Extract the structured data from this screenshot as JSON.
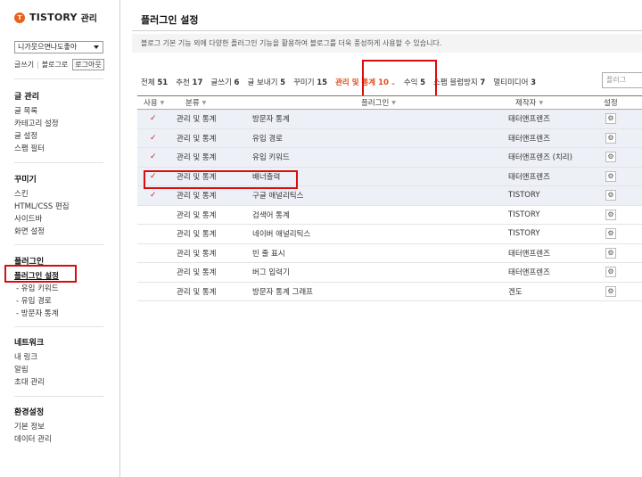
{
  "brand": {
    "logo_glyph": "T",
    "name": "TISTORY",
    "sub": "관리"
  },
  "blog_select": {
    "value": "니가뭇으면나도좋아"
  },
  "side_links": {
    "write": "글쓰기",
    "blog": "블로그로",
    "logout": "로그아웃"
  },
  "menu": {
    "posts": {
      "head": "글 관리",
      "items": [
        "글 목록",
        "카테고리 설정",
        "글 설정",
        "스팸 필터"
      ]
    },
    "decor": {
      "head": "꾸미기",
      "items": [
        "스킨",
        "HTML/CSS 편집",
        "사이드바",
        "화면 설정"
      ]
    },
    "plugins": {
      "head": "플러그인",
      "active": "플러그인 설정",
      "subs": [
        "- 유입 키워드",
        "- 유입 경로",
        "- 방문자 통계"
      ]
    },
    "network": {
      "head": "네트워크",
      "items": [
        "내 링크",
        "알림",
        "초대 관리"
      ]
    },
    "settings": {
      "head": "환경설정",
      "items": [
        "기본 정보",
        "데이터 관리"
      ]
    }
  },
  "page": {
    "title": "플러그인 설정",
    "description": "블로그 기본 기능 외에 다양한 플러그인 기능을 활용하여 블로그를 더욱 풍성하게 사용할 수 있습니다.",
    "search_placeholder": "플러그"
  },
  "tabs": [
    {
      "label": "전체",
      "count": "51"
    },
    {
      "label": "추천",
      "count": "17"
    },
    {
      "label": "글쓰기",
      "count": "6"
    },
    {
      "label": "글 보내기",
      "count": "5"
    },
    {
      "label": "꾸미기",
      "count": "15"
    },
    {
      "label": "관리 및 통계",
      "count": "10",
      "active": true,
      "chevron": "⌄"
    },
    {
      "label": "수익",
      "count": "5"
    },
    {
      "label": "스팸 블럼방지",
      "count": "7"
    },
    {
      "label": "멀티미디어",
      "count": "3"
    }
  ],
  "table": {
    "headers": {
      "use": "사용",
      "category": "분류",
      "plugin": "플러그인",
      "author": "제작자",
      "settings": "설정"
    },
    "rows": [
      {
        "enabled": true,
        "category": "관리 및 통계",
        "plugin": "방문자 통계",
        "author": "태터앤프렌즈"
      },
      {
        "enabled": true,
        "category": "관리 및 통계",
        "plugin": "유입 경로",
        "author": "태터앤프렌즈"
      },
      {
        "enabled": true,
        "category": "관리 및 통계",
        "plugin": "유입 키워드",
        "author": "태터앤프렌즈 (치리)"
      },
      {
        "enabled": true,
        "category": "관리 및 통계",
        "plugin": "배너출력",
        "author": "태터앤프렌즈"
      },
      {
        "enabled": true,
        "category": "관리 및 통계",
        "plugin": "구글 애널리틱스",
        "author": "TISTORY"
      },
      {
        "enabled": false,
        "category": "관리 및 통계",
        "plugin": "검색어 통계",
        "author": "TISTORY"
      },
      {
        "enabled": false,
        "category": "관리 및 통계",
        "plugin": "네이버 애널리틱스",
        "author": "TISTORY"
      },
      {
        "enabled": false,
        "category": "관리 및 통계",
        "plugin": "빈 줄 표시",
        "author": "태터앤프렌즈"
      },
      {
        "enabled": false,
        "category": "관리 및 통계",
        "plugin": "버그 입력기",
        "author": "태터앤프렌즈"
      },
      {
        "enabled": false,
        "category": "관리 및 통계",
        "plugin": "방문자 통계 그래프",
        "author": "겐도"
      }
    ],
    "check_glyph": "✓",
    "gear_glyph": "⚙"
  },
  "colors": {
    "accent": "#e34a16",
    "highlight_box": "#d80d0d",
    "enabled_row": "#eef0f7"
  }
}
